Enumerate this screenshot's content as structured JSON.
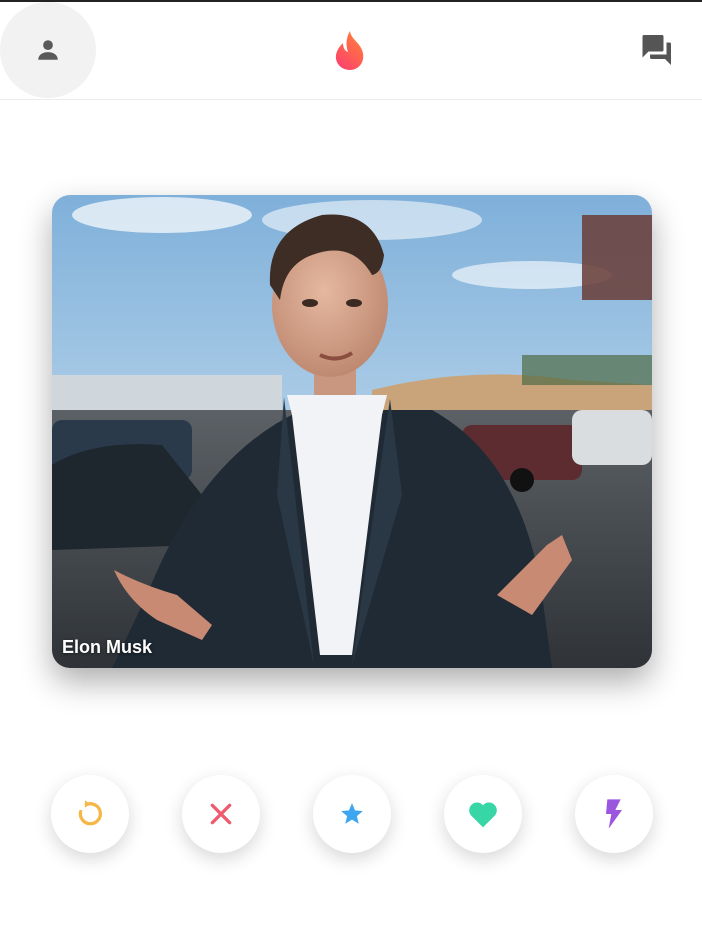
{
  "header": {
    "profile_icon": "person-icon",
    "logo_icon": "flame-icon",
    "messages_icon": "chat-bubbles-icon"
  },
  "card": {
    "name": "Elon Musk"
  },
  "actions": [
    {
      "icon": "rewind-icon",
      "color": "#f5b745"
    },
    {
      "icon": "close-icon",
      "color": "#ef5a6f"
    },
    {
      "icon": "star-icon",
      "color": "#3ea6f0"
    },
    {
      "icon": "heart-icon",
      "color": "#38d6a6"
    },
    {
      "icon": "boost-bolt-icon",
      "color": "#9b56e0"
    }
  ],
  "colors": {
    "brand": "#fe4a6a",
    "brand_secondary": "#ff7a3c",
    "header_icon": "#555555"
  }
}
